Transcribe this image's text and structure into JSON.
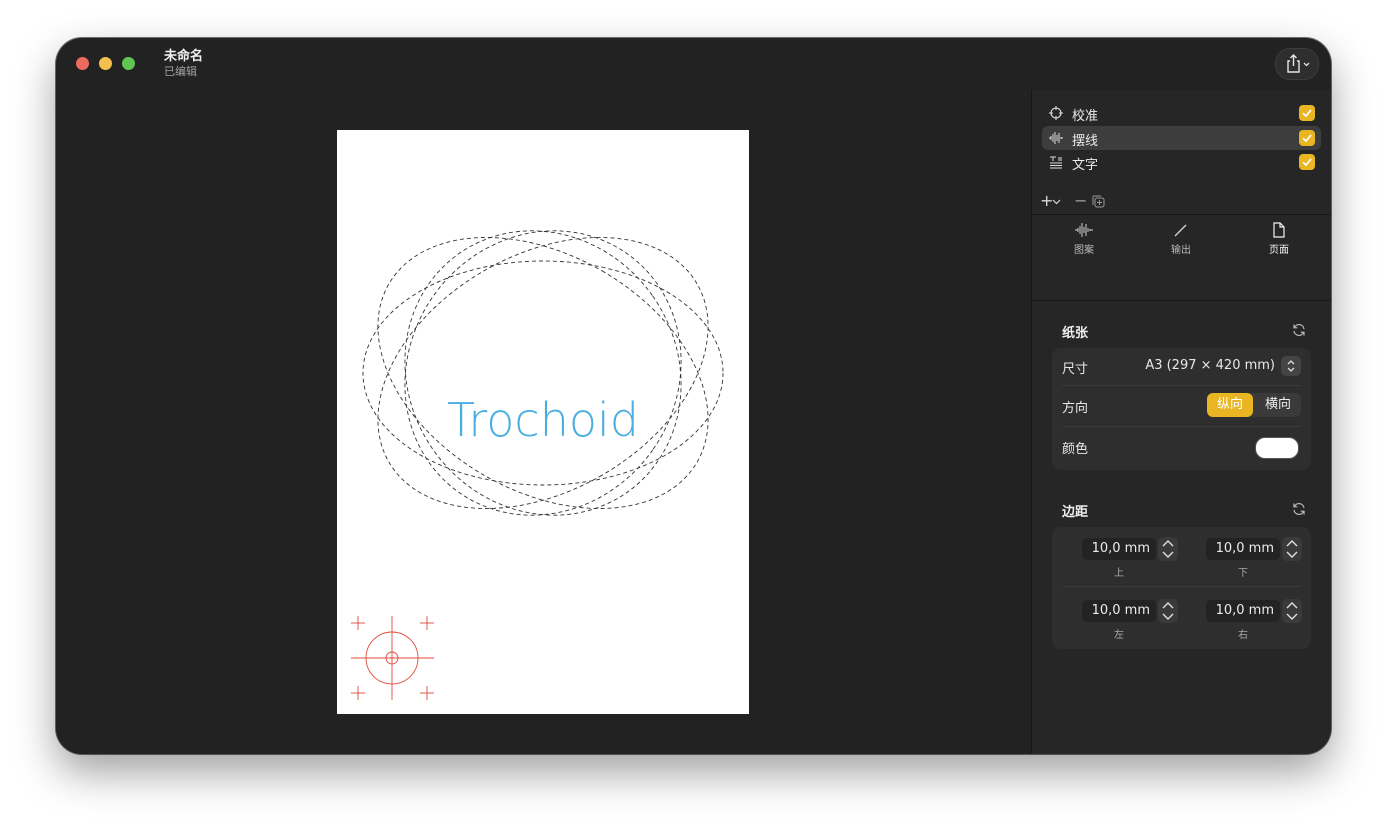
{
  "window": {
    "title": "未命名",
    "subtitle": "已编辑"
  },
  "canvas": {
    "text": "Trochoid"
  },
  "layers": [
    {
      "label": "校准",
      "icon": "crosshair-icon",
      "checked": true,
      "selected": false
    },
    {
      "label": "摆线",
      "icon": "waveform-icon",
      "checked": true,
      "selected": true
    },
    {
      "label": "文字",
      "icon": "text-format-icon",
      "checked": true,
      "selected": false
    }
  ],
  "layer_toolbar": {
    "add": "+",
    "remove": "−"
  },
  "tabs": [
    {
      "label": "图案",
      "icon": "waveform-icon",
      "active": false
    },
    {
      "label": "输出",
      "icon": "pen-icon",
      "active": false
    },
    {
      "label": "页面",
      "icon": "page-icon",
      "active": true
    }
  ],
  "paper_section": {
    "title": "纸张",
    "size_label": "尺寸",
    "size_value": "A3 (297 × 420 mm)",
    "orientation_label": "方向",
    "orientation_options": [
      "纵向",
      "横向"
    ],
    "orientation_selected": "纵向",
    "color_label": "颜色",
    "color_value": "#ffffff"
  },
  "margin_section": {
    "title": "边距",
    "top": {
      "value": "10,0 mm",
      "caption": "上"
    },
    "bottom": {
      "value": "10,0 mm",
      "caption": "下"
    },
    "left": {
      "value": "10,0 mm",
      "caption": "左"
    },
    "right": {
      "value": "10,0 mm",
      "caption": "右"
    }
  },
  "colors": {
    "accent": "#e9b523",
    "trochoid_text": "#4aaee0",
    "calibration_mark": "#e04a3a"
  }
}
